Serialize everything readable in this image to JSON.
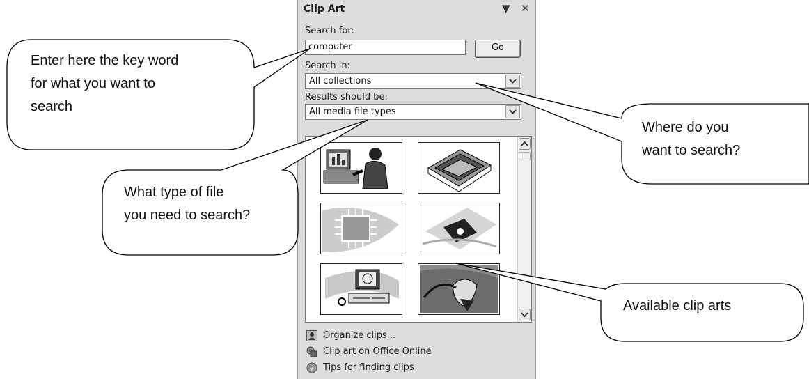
{
  "pane": {
    "title": "Clip Art",
    "dropdown_glyph": "▼",
    "close_glyph": "✕",
    "search_for_label": "Search for:",
    "search_value": "computer",
    "go_label": "Go",
    "search_in_label": "Search in:",
    "search_in_value": "All collections",
    "results_label": "Results should be:",
    "results_value": "All media file types",
    "clips": [
      {
        "name": "person-at-computer-clip"
      },
      {
        "name": "floppy-disk-tray-clip"
      },
      {
        "name": "circuit-board-clip"
      },
      {
        "name": "floppy-disk-clip"
      },
      {
        "name": "desktop-computer-globe-clip"
      },
      {
        "name": "computer-mouse-clip"
      }
    ],
    "links": [
      {
        "label": "Organize clips...",
        "icon": "organize-clips-icon"
      },
      {
        "label": "Clip art on Office Online",
        "icon": "office-online-icon"
      },
      {
        "label": "Tips for finding clips",
        "icon": "help-icon"
      }
    ]
  },
  "callouts": {
    "keyword": [
      "Enter here the key word",
      "for what you want to",
      "search"
    ],
    "where": [
      "Where do you",
      "want to search?"
    ],
    "filetype": [
      "What type of file",
      "you need to search?"
    ],
    "available": [
      "Available clip arts"
    ]
  }
}
